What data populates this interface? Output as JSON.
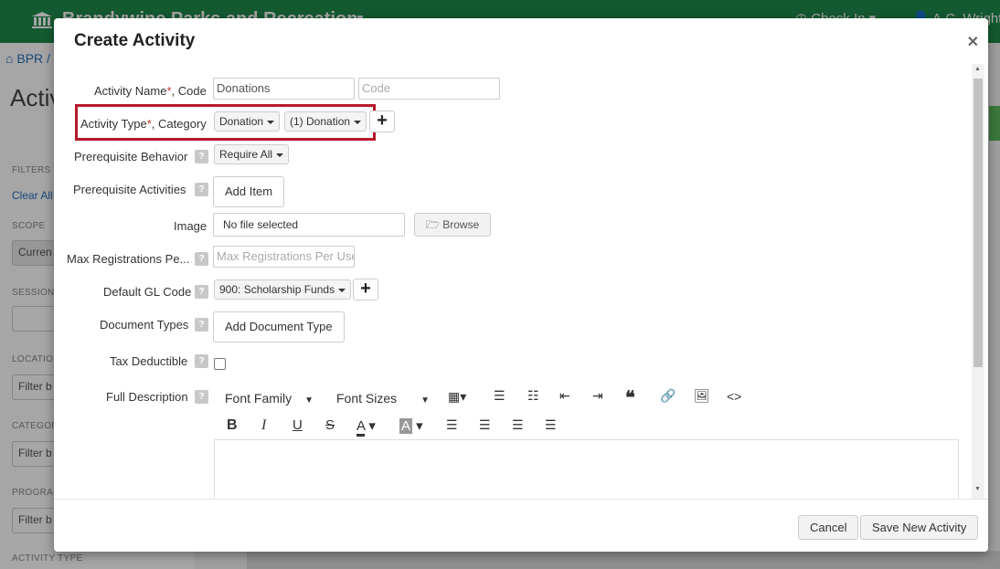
{
  "background": {
    "brand": "Brandywine Parks and Recreation",
    "check_in": "Check In",
    "user": "A.C. Wright",
    "breadcrumb": "BPR",
    "page_title_partial": "Activ",
    "filters_label": "FILTERS",
    "clear_all": "Clear All",
    "scope_label": "SCOPE",
    "scope_value": "Curren",
    "session_label": "SESSION",
    "location_label": "LOCATION",
    "location_placeholder": "Filter b",
    "category_label": "CATEGOR",
    "category_placeholder": "Filter b",
    "program_label": "PROGRAM",
    "program_placeholder": "Filter b",
    "activity_type_label": "ACTIVITY TYPE"
  },
  "modal": {
    "title": "Create Activity",
    "close_icon": "close-icon",
    "fields": {
      "activity_name": {
        "label": "Activity Name",
        "required_mark": "*",
        "label_suffix": ", Code",
        "name_value": "Donations",
        "code_placeholder": "Code"
      },
      "activity_type": {
        "label": "Activity Type",
        "required_mark": "*",
        "label_suffix": ", Category",
        "type_value": "Donation",
        "category_value": "(1) Donation"
      },
      "prerequisite_behavior": {
        "label": "Prerequisite Behavior",
        "value": "Require All"
      },
      "prerequisite_activities": {
        "label": "Prerequisite Activities",
        "button": "Add Item"
      },
      "image": {
        "label": "Image",
        "value": "No file selected",
        "browse": "Browse"
      },
      "max_registrations": {
        "label": "Max Registrations Pe...",
        "placeholder": "Max Registrations Per User"
      },
      "default_gl_code": {
        "label": "Default GL Code",
        "value": "900: Scholarship Funds"
      },
      "document_types": {
        "label": "Document Types",
        "button": "Add Document Type"
      },
      "tax_deductible": {
        "label": "Tax Deductible",
        "checked": false
      },
      "full_description": {
        "label": "Full Description",
        "font_family": "Font Family",
        "font_sizes": "Font Sizes"
      }
    },
    "help_glyph": "?",
    "footer": {
      "cancel": "Cancel",
      "save": "Save New Activity"
    }
  },
  "colors": {
    "brand_green": "#1f8a4c",
    "highlight_red": "#b7192b",
    "required_red": "#c0392b"
  }
}
